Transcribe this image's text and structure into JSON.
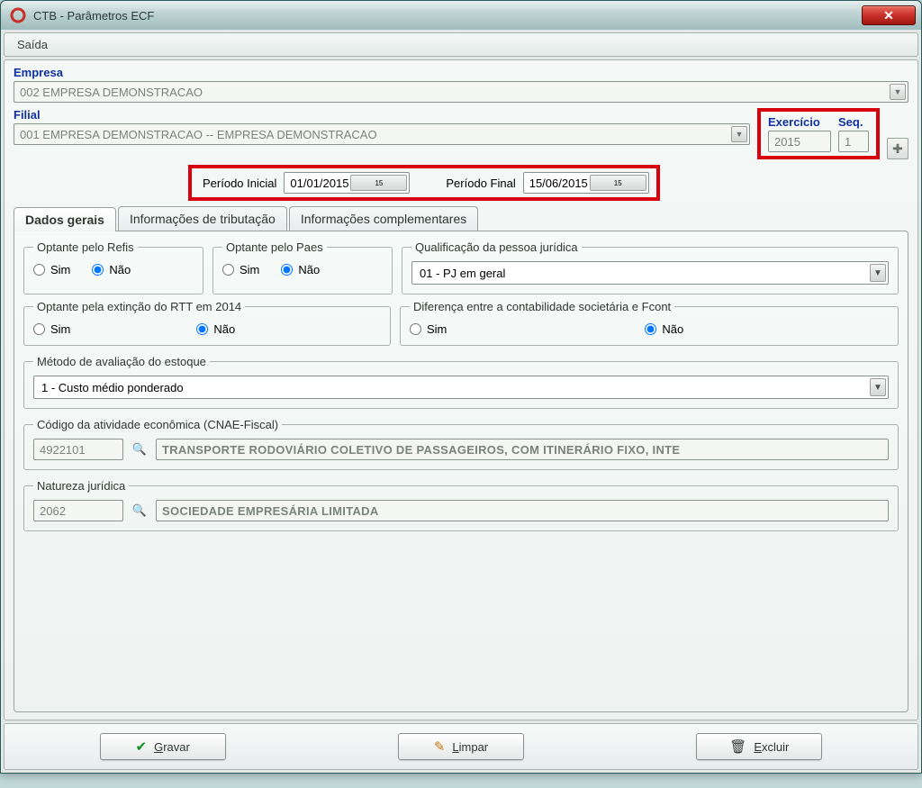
{
  "window": {
    "title": "CTB - Parâmetros ECF",
    "close_glyph": "✕"
  },
  "menu": {
    "exit": "Saída"
  },
  "header": {
    "empresa_label": "Empresa",
    "empresa_value": "002 EMPRESA DEMONSTRACAO",
    "filial_label": "Filial",
    "filial_value": "001 EMPRESA DEMONSTRACAO -- EMPRESA DEMONSTRACAO",
    "exercicio_label": "Exercício",
    "exercicio_value": "2015",
    "seq_label": "Seq.",
    "seq_value": "1"
  },
  "period": {
    "initial_label": "Período Inicial",
    "initial_value": "01/01/2015",
    "final_label": "Período Final",
    "final_value": "15/06/2015",
    "cal_glyph": "15"
  },
  "tabs": {
    "t1": "Dados gerais",
    "t2": "Informações de tributação",
    "t3": "Informações complementares"
  },
  "labels": {
    "sim": "Sim",
    "nao": "Não"
  },
  "groups": {
    "refis": {
      "title": "Optante pelo Refis"
    },
    "paes": {
      "title": "Optante pelo Paes"
    },
    "qualif": {
      "title": "Qualificação da pessoa jurídica",
      "value": "01 - PJ em geral"
    },
    "rtt": {
      "title": "Optante pela extinção do RTT em 2014"
    },
    "fcont": {
      "title": "Diferença entre a contabilidade societária e Fcont"
    },
    "estoque": {
      "title": "Método de avaliação do estoque",
      "value": "1 - Custo médio ponderado"
    },
    "cnae": {
      "title": "Código da atividade econômica (CNAE-Fiscal)",
      "code": "4922101",
      "desc": "TRANSPORTE RODOVIÁRIO COLETIVO DE PASSAGEIROS, COM ITINERÁRIO FIXO, INTE"
    },
    "natureza": {
      "title": "Natureza jurídica",
      "code": "2062",
      "desc": "SOCIEDADE EMPRESÁRIA LIMITADA"
    }
  },
  "buttons": {
    "gravar_pre": "G",
    "gravar_rest": "ravar",
    "limpar_pre": "L",
    "limpar_rest": "impar",
    "excluir_pre": "E",
    "excluir_rest": "xcluir"
  }
}
